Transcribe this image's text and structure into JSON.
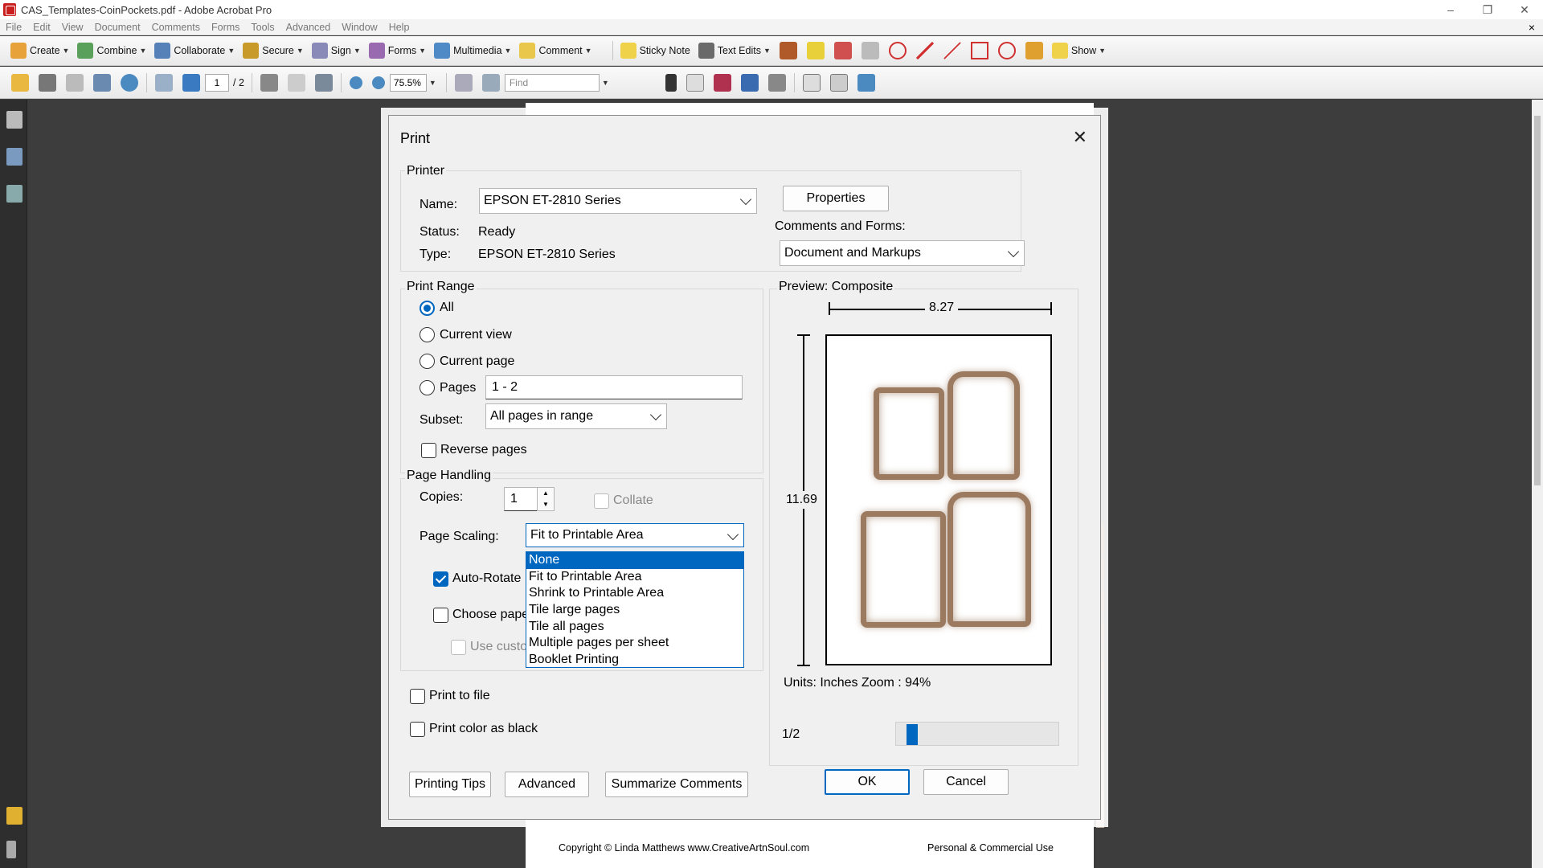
{
  "window": {
    "title": "CAS_Templates-CoinPockets.pdf - Adobe Acrobat Pro",
    "controls": [
      "–",
      "❐",
      "✕"
    ]
  },
  "menu": [
    "File",
    "Edit",
    "View",
    "Document",
    "Comments",
    "Forms",
    "Tools",
    "Advanced",
    "Window",
    "Help"
  ],
  "menu_close": "×",
  "toolbar1": {
    "create": "Create",
    "combine": "Combine",
    "collaborate": "Collaborate",
    "secure": "Secure",
    "sign": "Sign",
    "forms": "Forms",
    "multimedia": "Multimedia",
    "comment": "Comment",
    "sticky_note": "Sticky Note",
    "text_edits": "Text Edits",
    "show": "Show"
  },
  "toolbar2": {
    "current_page": "1",
    "total_pages": "/ 2",
    "zoom": "75.5%",
    "find_placeholder": "Find"
  },
  "document": {
    "footer_left": "Copyright © Linda Matthews www.CreativeArtnSoul.com",
    "footer_right": "Personal & Commercial Use"
  },
  "dialog": {
    "title": "Print",
    "printer": {
      "group_label": "Printer",
      "name_label": "Name:",
      "name_value": "EPSON ET-2810 Series",
      "properties_button": "Properties",
      "status_label": "Status:",
      "status_value": "Ready",
      "type_label": "Type:",
      "type_value": "EPSON ET-2810 Series",
      "comments_forms_label": "Comments and Forms:",
      "comments_forms_value": "Document and Markups"
    },
    "print_range": {
      "group_label": "Print Range",
      "all": "All",
      "current_view": "Current view",
      "current_page": "Current page",
      "pages": "Pages",
      "pages_value": "1 - 2",
      "subset_label": "Subset:",
      "subset_value": "All pages in range",
      "reverse_pages": "Reverse pages"
    },
    "page_handling": {
      "group_label": "Page Handling",
      "copies_label": "Copies:",
      "copies_value": "1",
      "collate": "Collate",
      "page_scaling_label": "Page Scaling:",
      "page_scaling_value": "Fit to Printable Area",
      "auto_rotate": "Auto-Rotate",
      "choose_paper": "Choose pape",
      "use_custom": "Use custo",
      "scaling_options": [
        "None",
        "Fit to Printable Area",
        "Shrink to Printable Area",
        "Tile large pages",
        "Tile all pages",
        "Multiple pages per sheet",
        "Booklet Printing"
      ],
      "scaling_highlighted": "None"
    },
    "print_to_file": "Print to file",
    "print_color_as_black": "Print color as black",
    "preview": {
      "label": "Preview: Composite",
      "width": "8.27",
      "height": "11.69",
      "units_zoom": "Units: Inches Zoom :  94%",
      "page_indicator": "1/2",
      "page_progress_fraction": 0.07
    },
    "buttons": {
      "printing_tips": "Printing Tips",
      "advanced": "Advanced",
      "summarize_comments": "Summarize Comments",
      "ok": "OK",
      "cancel": "Cancel"
    }
  },
  "colors": {
    "accent": "#0067c0",
    "pocket_brown": "#9b7a60",
    "workspace": "#3d3d3d"
  }
}
